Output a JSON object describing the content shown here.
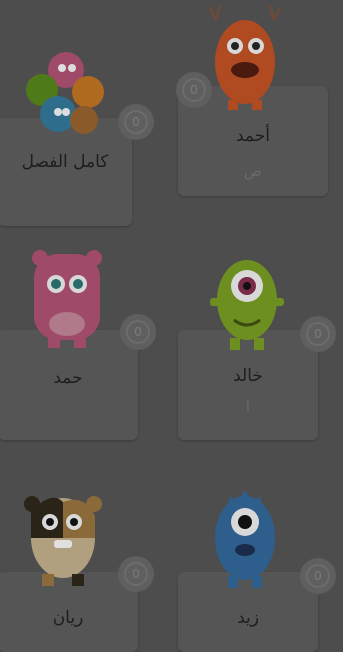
{
  "students": [
    {
      "name": "أحمد",
      "points": "0",
      "sub": "ص",
      "avatar": "orange-monster-icon"
    },
    {
      "name": "كامل الفصل",
      "points": "0",
      "avatar": "whole-class-group-icon"
    },
    {
      "name": "خالد",
      "points": "0",
      "sub": "ا",
      "avatar": "green-cyclops-monster-icon"
    },
    {
      "name": "حمد",
      "points": "0",
      "avatar": "pink-monster-icon"
    },
    {
      "name": "زيد",
      "points": "0",
      "avatar": "blue-cyclops-monster-icon"
    },
    {
      "name": "ريان",
      "points": "0",
      "avatar": "calico-monster-icon"
    }
  ],
  "colors": {
    "overlay": "#4d4d4d",
    "orange": "#b04a20",
    "green": "#6d8f1f",
    "pink": "#a04a6a",
    "blue": "#2e5f8c",
    "calico": "#8b6a3a"
  }
}
